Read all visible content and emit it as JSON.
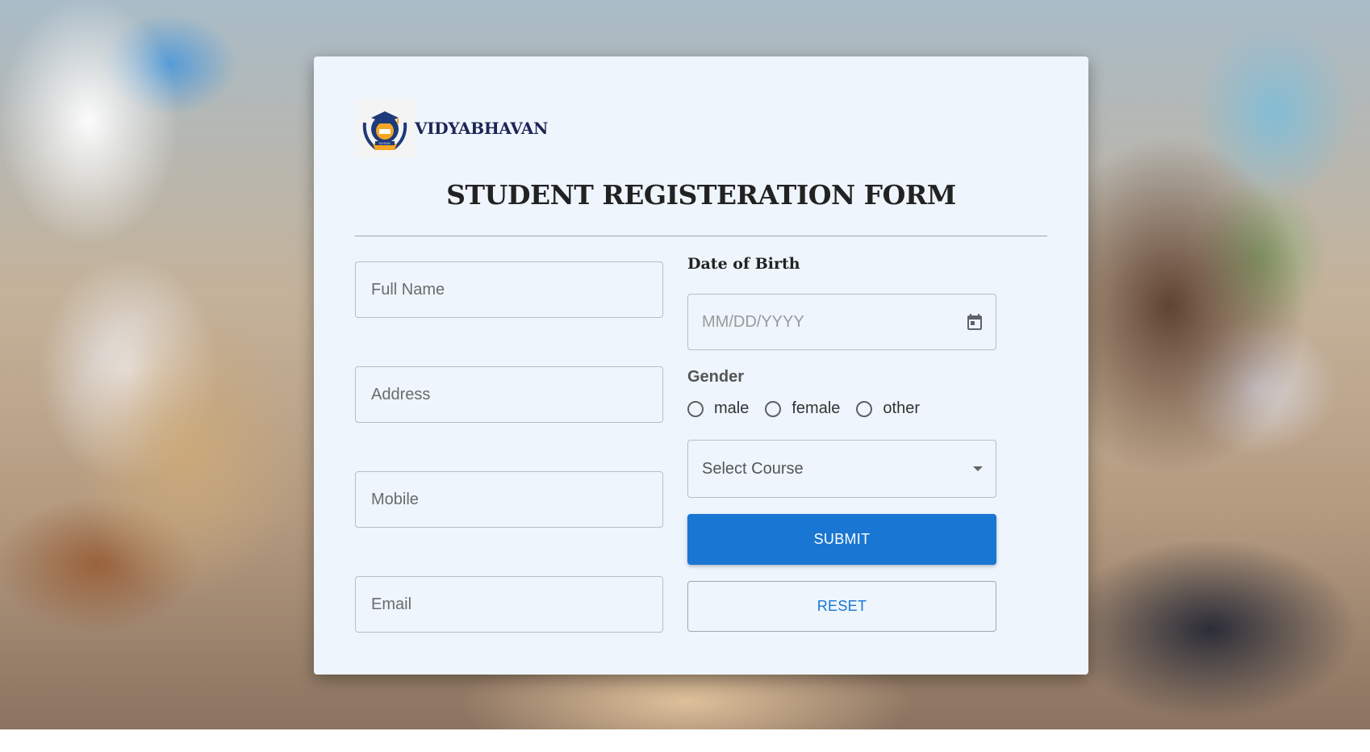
{
  "brand": {
    "name": "VIDYABHAVAN",
    "logo_icon": "graduation-cap-laurel-icon",
    "logo_text": "SCHOOL"
  },
  "form": {
    "title": "STUDENT REGISTERATION FORM",
    "fields": {
      "full_name": {
        "placeholder": "Full Name"
      },
      "address": {
        "placeholder": "Address"
      },
      "mobile": {
        "placeholder": "Mobile"
      },
      "email": {
        "placeholder": "Email"
      }
    },
    "dob": {
      "label": "Date of Birth",
      "placeholder": "MM/DD/YYYY",
      "icon": "calendar-icon"
    },
    "gender": {
      "label": "Gender",
      "options": [
        "male",
        "female",
        "other"
      ]
    },
    "course": {
      "placeholder": "Select Course",
      "icon": "chevron-down-icon"
    },
    "submit_label": "SUBMIT",
    "reset_label": "RESET"
  },
  "colors": {
    "primary": "#1976d2",
    "card_background": "#eef5fd",
    "brand_text": "#1d2555"
  }
}
